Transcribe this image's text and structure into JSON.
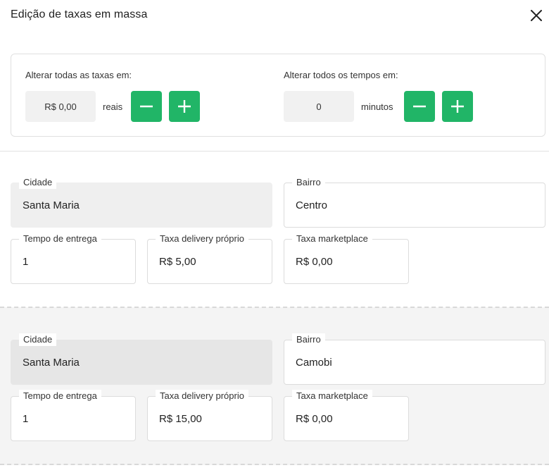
{
  "header": {
    "title": "Edição de taxas em massa",
    "close_icon": "close-icon"
  },
  "bulk": {
    "fees_label": "Alterar todas as taxas em:",
    "fees_value": "R$ 0,00",
    "fees_unit": "reais",
    "times_label": "Alterar todos os tempos em:",
    "times_value": "0",
    "times_unit": "minutos",
    "minus_icon": "minus-icon",
    "plus_icon": "plus-icon",
    "button_color": "#21b567"
  },
  "rows": [
    {
      "cidade_label": "Cidade",
      "cidade": "Santa Maria",
      "bairro_label": "Bairro",
      "bairro": "Centro",
      "tempo_label": "Tempo de entrega",
      "tempo": "1",
      "delivery_label": "Taxa delivery próprio",
      "delivery": "R$ 5,00",
      "marketplace_label": "Taxa marketplace",
      "marketplace": "R$ 0,00"
    },
    {
      "cidade_label": "Cidade",
      "cidade": "Santa Maria",
      "bairro_label": "Bairro",
      "bairro": "Camobi",
      "tempo_label": "Tempo de entrega",
      "tempo": "1",
      "delivery_label": "Taxa delivery próprio",
      "delivery": "R$ 15,00",
      "marketplace_label": "Taxa marketplace",
      "marketplace": "R$ 0,00"
    }
  ]
}
